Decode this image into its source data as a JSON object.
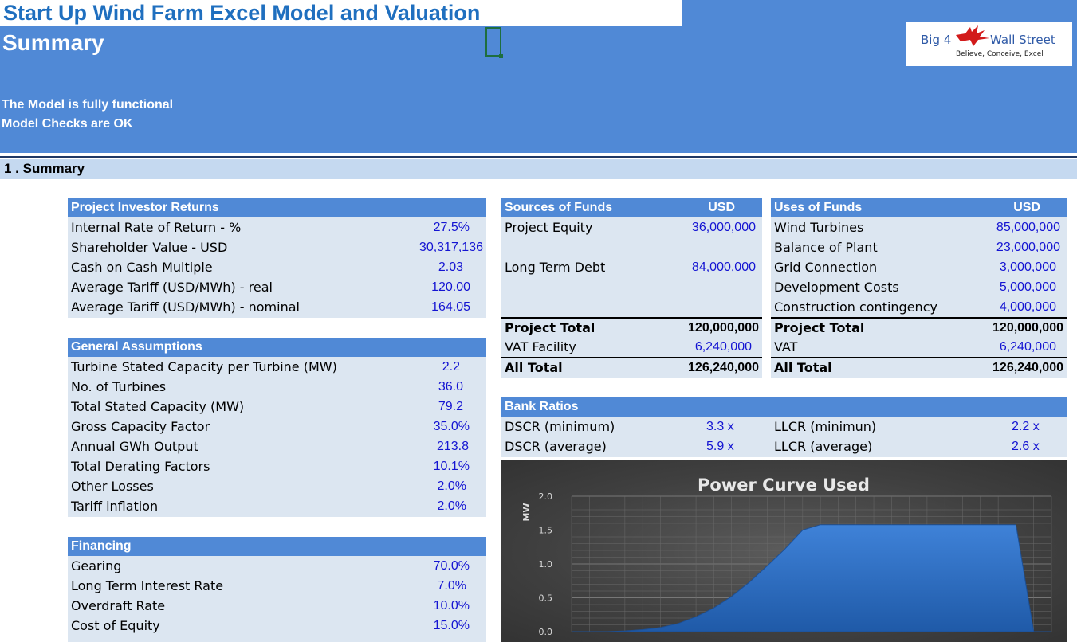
{
  "header": {
    "title": "Start Up Wind Farm Excel Model and Valuation",
    "subtitle": "Summary",
    "status_lines": [
      "The Model is fully functional",
      "Model Checks are OK"
    ],
    "accent_color": "#5089d6"
  },
  "logo": {
    "left": "Big 4",
    "right": "Wall Street",
    "tagline": "Believe, Conceive, Excel",
    "icon": "eagle-icon"
  },
  "section": {
    "title": "1 . Summary"
  },
  "investor_returns": {
    "title": "Project Investor Returns",
    "rows": [
      {
        "label": "Internal Rate of Return - %",
        "value": "27.5%"
      },
      {
        "label": "Shareholder Value - USD",
        "value": "30,317,136"
      },
      {
        "label": "Cash on Cash Multiple",
        "value": "2.03"
      },
      {
        "label": "Average Tariff (USD/MWh) - real",
        "value": "120.00"
      },
      {
        "label": "Average Tariff (USD/MWh) - nominal",
        "value": "164.05"
      }
    ]
  },
  "general_assumptions": {
    "title": "General Assumptions",
    "rows": [
      {
        "label": "Turbine Stated Capacity per Turbine (MW)",
        "value": "2.2"
      },
      {
        "label": "No. of Turbines",
        "value": "36.0"
      },
      {
        "label": "Total Stated Capacity (MW)",
        "value": "79.2"
      },
      {
        "label": "Gross Capacity Factor",
        "value": "35.0%"
      },
      {
        "label": "Annual GWh Output",
        "value": "213.8"
      },
      {
        "label": "Total Derating Factors",
        "value": "10.1%"
      },
      {
        "label": "Other Losses",
        "value": "2.0%"
      },
      {
        "label": "Tariff inflation",
        "value": "2.0%"
      }
    ]
  },
  "financing": {
    "title": "Financing",
    "rows": [
      {
        "label": "Gearing",
        "value": "70.0%"
      },
      {
        "label": "Long Term Interest Rate",
        "value": "7.0%"
      },
      {
        "label": "Overdraft Rate",
        "value": "10.0%"
      },
      {
        "label": "Cost of Equity",
        "value": "15.0%"
      }
    ]
  },
  "sources": {
    "title": "Sources of Funds",
    "currency": "USD",
    "rows": [
      {
        "label": "Project Equity",
        "value": "36,000,000"
      },
      {
        "label": "",
        "value": ""
      },
      {
        "label": "Long Term Debt",
        "value": "84,000,000"
      },
      {
        "label": "",
        "value": ""
      },
      {
        "label": "",
        "value": ""
      },
      {
        "label": "Project Total",
        "value": "120,000,000"
      },
      {
        "label": "VAT Facility",
        "value": "6,240,000"
      },
      {
        "label": "All Total",
        "value": "126,240,000"
      }
    ]
  },
  "uses": {
    "title": "Uses of Funds",
    "currency": "USD",
    "rows": [
      {
        "label": "Wind Turbines",
        "value": "85,000,000"
      },
      {
        "label": "Balance of Plant",
        "value": "23,000,000"
      },
      {
        "label": "Grid Connection",
        "value": "3,000,000"
      },
      {
        "label": "Development Costs",
        "value": "5,000,000"
      },
      {
        "label": "Construction contingency",
        "value": "4,000,000"
      },
      {
        "label": "Project Total",
        "value": "120,000,000"
      },
      {
        "label": "VAT",
        "value": "6,240,000"
      },
      {
        "label": "All Total",
        "value": "126,240,000"
      }
    ]
  },
  "bank_ratios": {
    "title": "Bank Ratios",
    "rows": [
      {
        "label": "DSCR (minimum)",
        "value": "3.3 x",
        "label2": "LLCR (minimun)",
        "value2": "2.2 x"
      },
      {
        "label": "DSCR (average)",
        "value": "5.9 x",
        "label2": "LLCR (average)",
        "value2": "2.6 x"
      }
    ]
  },
  "chart_data": {
    "type": "area",
    "title": "Power Curve Used",
    "ylabel": "MW",
    "xlabel": "",
    "ylim": [
      0,
      2.0
    ],
    "yticks": [
      "0.0",
      "0.5",
      "1.0",
      "1.5",
      "2.0"
    ],
    "grid": true,
    "x": [
      0,
      1,
      2,
      3,
      4,
      5,
      6,
      7,
      8,
      9,
      10,
      11,
      12,
      13,
      14,
      15,
      16,
      17,
      18,
      19,
      20,
      21,
      22,
      23,
      24,
      25,
      26,
      27
    ],
    "values": [
      0,
      0,
      0,
      0.01,
      0.03,
      0.06,
      0.12,
      0.22,
      0.35,
      0.52,
      0.73,
      0.97,
      1.22,
      1.5,
      1.58,
      1.58,
      1.58,
      1.58,
      1.58,
      1.58,
      1.58,
      1.58,
      1.58,
      1.58,
      1.58,
      1.58,
      0,
      0
    ],
    "colors": {
      "fill": "#2f6fc4",
      "background": "#404040",
      "grid": "#6a6a6a"
    }
  }
}
